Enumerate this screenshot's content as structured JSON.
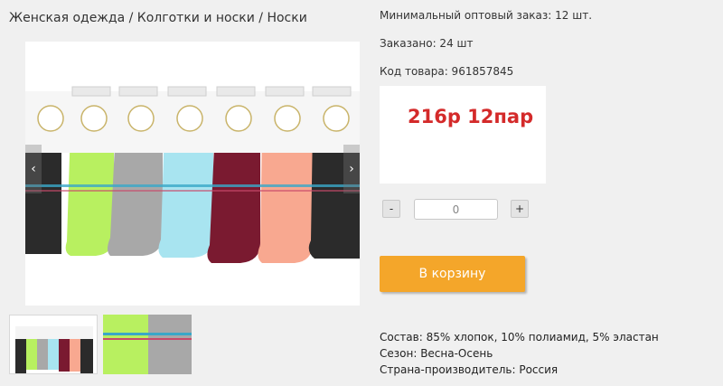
{
  "breadcrumb": "Женская одежда / Колготки и носки / Носки",
  "product": {
    "min_order": "Минимальный оптовый заказ: 12 шт.",
    "ordered": "Заказано: 24 шт",
    "code": "Код товара: 961857845",
    "price": "216р 12пар",
    "quantity_value": "0",
    "minus_label": "-",
    "plus_label": "+",
    "cart_label": "В корзину",
    "composition": "Состав: 85% хлопок, 10% полиамид, 5% эластан",
    "season": "Сезон: Весна-Осень",
    "country": "Страна-производитель: Россия"
  },
  "colors": {
    "price": "#d42a2a",
    "cart_button": "#f4a62a",
    "socks": [
      "#2b2b2b",
      "#b8f060",
      "#a8a8a8",
      "#a8e4f0",
      "#7a1a30",
      "#f8a890",
      "#2b2b2b"
    ]
  },
  "icons": {
    "prev": "chevron-left-icon",
    "next": "chevron-right-icon"
  }
}
